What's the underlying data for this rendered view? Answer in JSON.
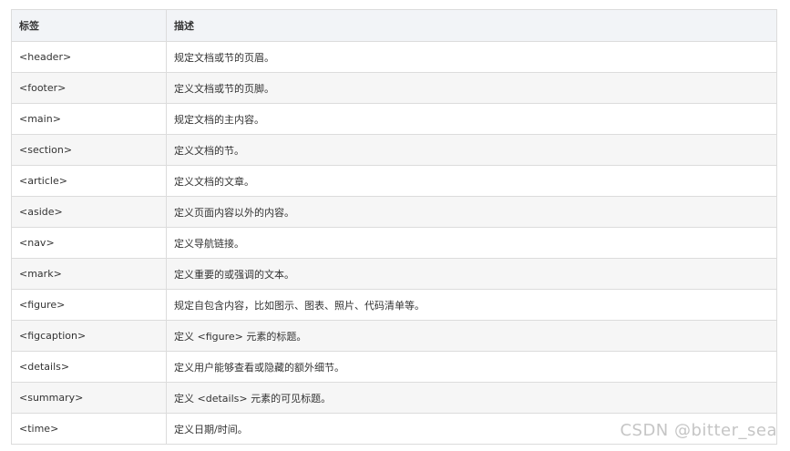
{
  "table": {
    "headers": [
      "标签",
      "描述"
    ],
    "rows": [
      {
        "tag": "<header>",
        "desc": "规定文档或节的页眉。"
      },
      {
        "tag": "<footer>",
        "desc": "定义文档或节的页脚。"
      },
      {
        "tag": "<main>",
        "desc": "规定文档的主内容。"
      },
      {
        "tag": "<section>",
        "desc": "定义文档的节。"
      },
      {
        "tag": "<article>",
        "desc": "定义文档的文章。"
      },
      {
        "tag": "<aside>",
        "desc": "定义页面内容以外的内容。"
      },
      {
        "tag": "<nav>",
        "desc": "定义导航链接。"
      },
      {
        "tag": "<mark>",
        "desc": "定义重要的或强调的文本。"
      },
      {
        "tag": "<figure>",
        "desc": "规定自包含内容，比如图示、图表、照片、代码清单等。"
      },
      {
        "tag": "<figcaption>",
        "desc": "定义 <figure> 元素的标题。"
      },
      {
        "tag": "<details>",
        "desc": "定义用户能够查看或隐藏的额外细节。"
      },
      {
        "tag": "<summary>",
        "desc": "定义 <details> 元素的可见标题。"
      },
      {
        "tag": "<time>",
        "desc": "定义日期/时间。"
      }
    ]
  },
  "watermark": "CSDN @bitter_sea",
  "colors": {
    "header_bg": "#f2f4f7",
    "stripe_bg": "#f6f6f6",
    "border": "#dcdcdc",
    "text": "#333333"
  }
}
